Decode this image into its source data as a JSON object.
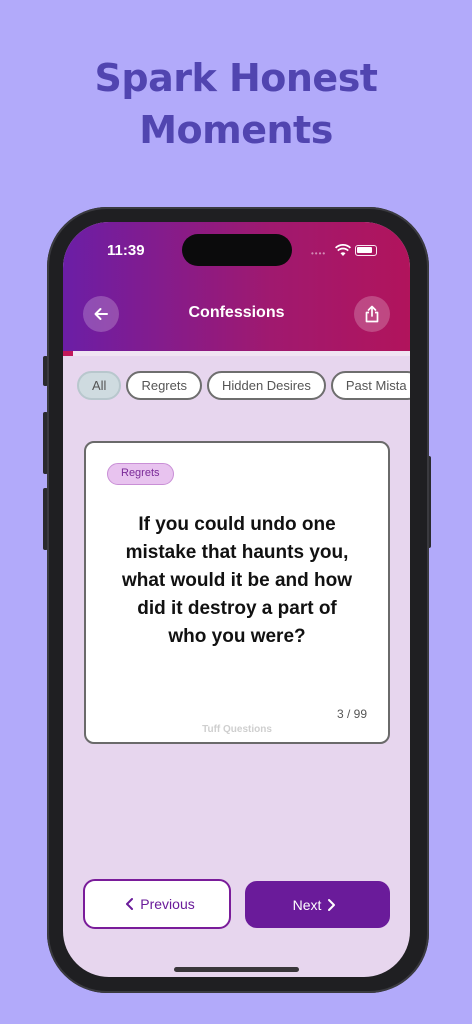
{
  "promo": {
    "headline_line1": "Spark Honest",
    "headline_line2": "Moments"
  },
  "status_bar": {
    "time": "11:39",
    "icons": [
      "cellular-dots-icon",
      "wifi-icon",
      "battery-icon"
    ]
  },
  "header": {
    "title": "Confessions",
    "back_icon": "arrow-left-icon",
    "share_icon": "share-icon",
    "gradient": [
      "#6b1ea6",
      "#b1145c"
    ],
    "progress_fraction": 0.03
  },
  "categories": [
    {
      "label": "All",
      "active": true
    },
    {
      "label": "Regrets",
      "active": false
    },
    {
      "label": "Hidden Desires",
      "active": false
    },
    {
      "label": "Past Mista",
      "active": false
    }
  ],
  "card": {
    "tag": "Regrets",
    "question": "If you could undo one mistake that haunts you, what would it be and how did it destroy a part of who you were?",
    "counter": "3 / 99",
    "watermark": "Tuff Questions"
  },
  "navigation": {
    "previous_label": "Previous",
    "next_label": "Next",
    "accent": "#6a1b9a"
  },
  "colors": {
    "background": "#b2aafa",
    "headline": "#5145b0",
    "screen": "#e7d6ee"
  }
}
